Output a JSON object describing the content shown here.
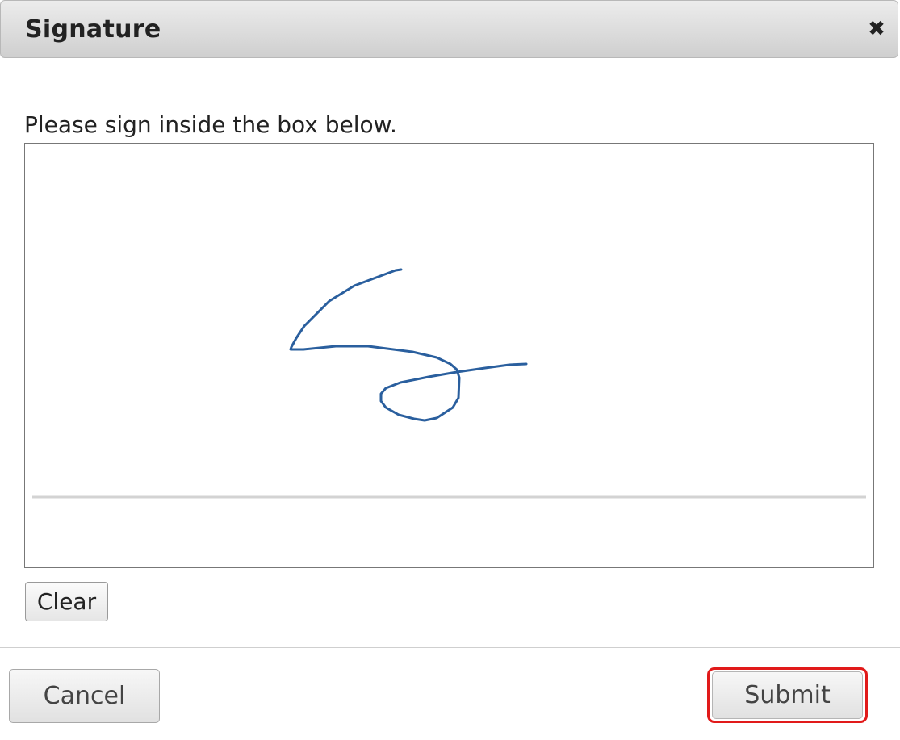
{
  "dialog": {
    "title": "Signature",
    "close_icon": "close-icon",
    "close_glyph": "✖"
  },
  "instruction": "Please sign inside the box below.",
  "signature_pad": {
    "stroke_color": "#2a5f9e",
    "baseline_color": "#d3d3d3",
    "has_signature": true
  },
  "buttons": {
    "clear_label": "Clear",
    "cancel_label": "Cancel",
    "submit_label": "Submit"
  },
  "colors": {
    "highlight": "#e11a1a",
    "titlebar": "#dcdcdc"
  }
}
